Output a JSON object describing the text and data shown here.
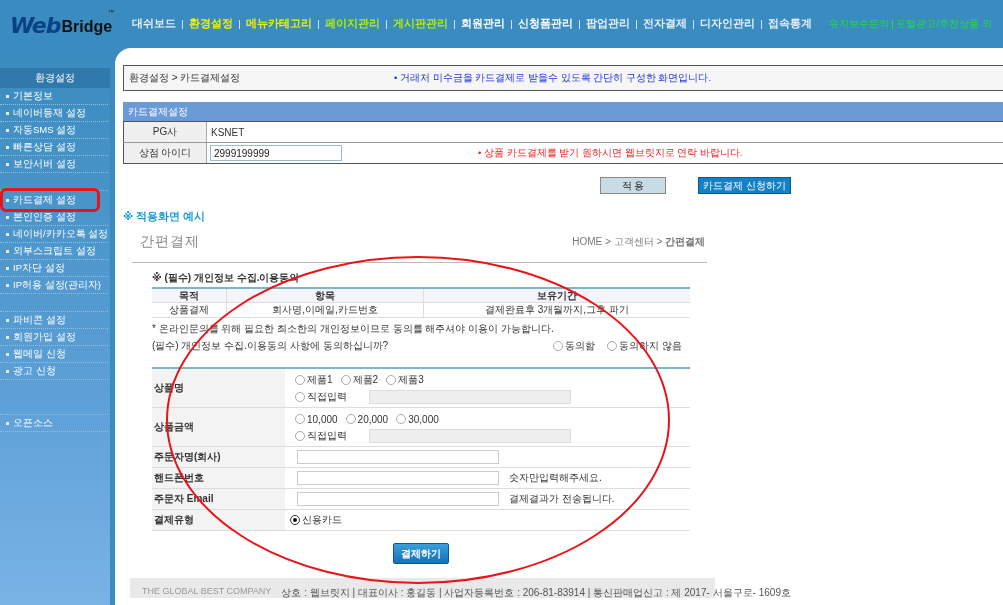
{
  "header": {
    "logo": {
      "word": "Web",
      "brand": "Bridge",
      "mark": "™"
    },
    "nav": [
      {
        "label": "대쉬보드",
        "color": "#e8f0f8"
      },
      {
        "label": "환경설정",
        "color": "#f2f200"
      },
      {
        "label": "메뉴카테고리",
        "color": "#f2f200"
      },
      {
        "label": "페이지관리",
        "color": "#b4f000"
      },
      {
        "label": "게시판관리",
        "color": "#b4f000"
      },
      {
        "label": "회원관리",
        "color": "#ffffff"
      },
      {
        "label": "신청폼관리",
        "color": "#ffffff"
      },
      {
        "label": "팝업관리",
        "color": "#e8f0f8"
      },
      {
        "label": "전자결제",
        "color": "#e8f0f8"
      },
      {
        "label": "디자인관리",
        "color": "#e8f0f8"
      },
      {
        "label": "접속통계",
        "color": "#e8f0f8"
      }
    ],
    "links": [
      "유지보수문의",
      "포털광고/추천상품 외"
    ]
  },
  "sidebar": {
    "title": "환경설정",
    "groups": [
      [
        {
          "label": "기본정보",
          "highlighted": false
        },
        {
          "label": "네이버등재 설정",
          "highlighted": false
        },
        {
          "label": "자동SMS 설정",
          "highlighted": false
        },
        {
          "label": "빠른상담 설정",
          "highlighted": false
        },
        {
          "label": "보안서버 설정",
          "highlighted": false
        }
      ],
      [
        {
          "label": "카드결제 설정",
          "highlighted": true
        },
        {
          "label": "본인인증 설정",
          "highlighted": false
        },
        {
          "label": "네이버/카카오톡 설정",
          "highlighted": false
        },
        {
          "label": "외부스크립트 설정",
          "highlighted": false
        },
        {
          "label": "IP차단 설정",
          "highlighted": false
        },
        {
          "label": "IP허용 설정(관리자)",
          "highlighted": false
        }
      ],
      [
        {
          "label": "파비콘 설정",
          "highlighted": false
        },
        {
          "label": "회원가입 설정",
          "highlighted": false
        },
        {
          "label": "웹메일 신청",
          "highlighted": false
        },
        {
          "label": "광고 신청",
          "highlighted": false
        }
      ],
      [
        {
          "label": "오픈소스",
          "highlighted": false
        }
      ]
    ]
  },
  "content": {
    "breadcrumb": "환경설정 > 카드결제설정",
    "notice": "• 거래처 미수금을 카드결제로 받을수 있도록 간단히 구성한 화면입니다.",
    "section_title": "카드결제설정",
    "rows": [
      {
        "label": "PG사",
        "kind": "text",
        "value": "KSNET"
      },
      {
        "label": "상점 아이디",
        "kind": "input",
        "value": "2999199999",
        "note": "• 상품 카드결제를 받기 원하시면 웹브릿지로 연락 바랍니다."
      }
    ],
    "buttons": [
      {
        "label": "적 용",
        "kind": "secondary"
      },
      {
        "label": "카드결제 신청하기",
        "kind": "primary"
      }
    ],
    "example_title": "※ 적용화면 예시"
  },
  "preview": {
    "title": "간편결제",
    "breadcrumb": "HOME > 고객센터 > **간편결제**",
    "consent_title": "※ (필수) 개인정보 수집.이용동의",
    "consent_columns": [
      "목적",
      "항목",
      "보유기간"
    ],
    "consent_rows": [
      [
        "상품결제",
        "회사명,이메일,카드번호",
        "결제완료후 3개월까지,그후 파기"
      ]
    ],
    "consent_note": "* 온라인문의를 위해 필요한 최소한의 개인정보이므로 동의를 해주셔야 이용이 가능합니다.",
    "consent_question": "(필수) 개인정보 수집.이용동의 사항에 동의하십니까?",
    "consent_options": [
      {
        "label": "동의함",
        "selected": false
      },
      {
        "label": "동의하지 않음",
        "selected": false
      }
    ],
    "form": [
      {
        "label": "상품명",
        "kind": "choice",
        "options": [
          {
            "label": "제품1",
            "selected": false
          },
          {
            "label": "제품2",
            "selected": false
          },
          {
            "label": "제품3",
            "selected": false
          }
        ],
        "custom": {
          "label": "직접입력",
          "selected": false
        }
      },
      {
        "label": "상품금액",
        "kind": "choice",
        "options": [
          {
            "label": "10,000",
            "selected": false
          },
          {
            "label": "20,000",
            "selected": false
          },
          {
            "label": "30,000",
            "selected": false
          }
        ],
        "custom": {
          "label": "직접입력",
          "selected": false
        }
      },
      {
        "label": "주문자명(회사)",
        "kind": "input"
      },
      {
        "label": "핸드폰번호",
        "kind": "input",
        "hint": "숫자만입력해주세요."
      },
      {
        "label": "주문자 Email",
        "kind": "input",
        "hint": "결제결과가 전송됩니다."
      },
      {
        "label": "결제유형",
        "kind": "radio",
        "options": [
          {
            "label": "신용카드",
            "selected": true
          }
        ]
      }
    ],
    "submit": "결제하기",
    "footer": {
      "slogan": "THE GLOBAL BEST COMPANY",
      "info": "상호 : 웹브릿지 | 대표이사 : 홍길동 | 사업자등록번호 : 206-81-83914 | 통신판매업신고 : 제 2017- 서울구로- 1609호"
    }
  }
}
